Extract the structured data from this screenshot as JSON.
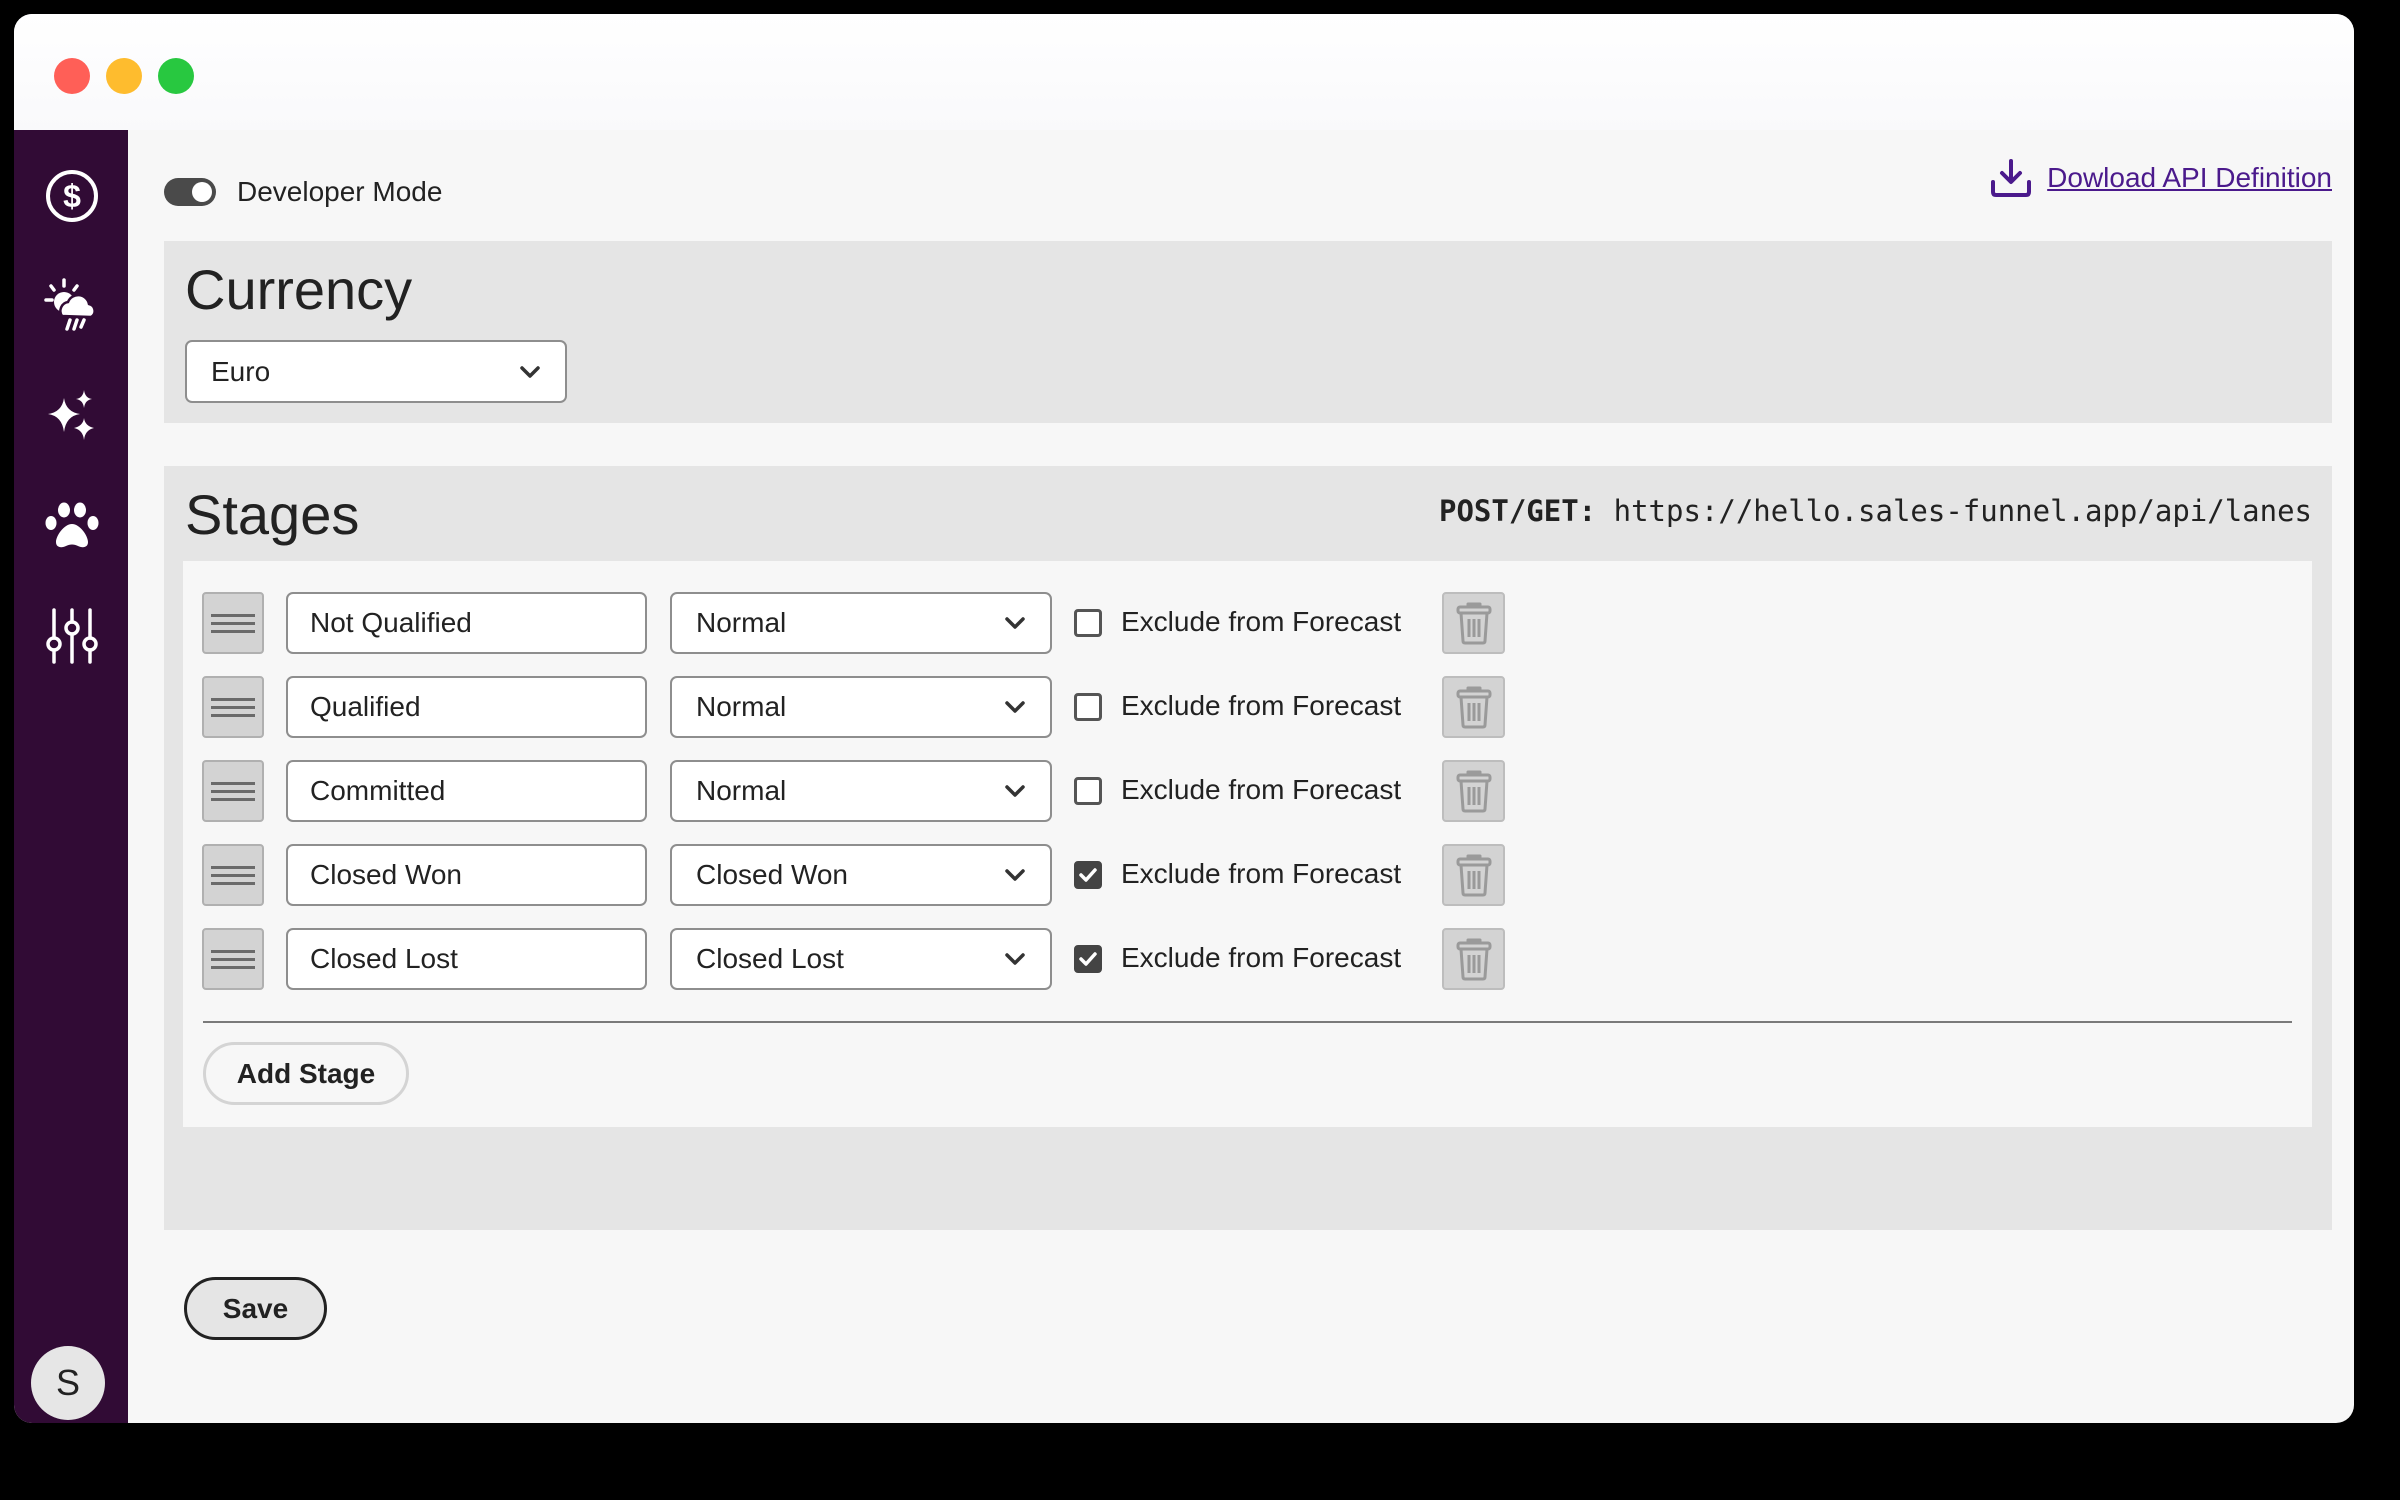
{
  "window": {
    "controls": [
      "close",
      "minimize",
      "maximize"
    ]
  },
  "sidebar": {
    "items": [
      {
        "icon": "dollar-circle-icon",
        "label": "Currency"
      },
      {
        "icon": "weather-sun-rain-icon",
        "label": "Forecast"
      },
      {
        "icon": "sparkles-icon",
        "label": "Magic"
      },
      {
        "icon": "paw-icon",
        "label": "Pets"
      },
      {
        "icon": "sliders-icon",
        "label": "Settings"
      }
    ],
    "avatar_initial": "S"
  },
  "header": {
    "developer_mode_label": "Developer Mode",
    "developer_mode_on": true,
    "download_label": "Dowload API Definition"
  },
  "currency": {
    "title": "Currency",
    "selected": "Euro"
  },
  "stages": {
    "title": "Stages",
    "endpoint_method": "POST/GET:",
    "endpoint_url": "https://hello.sales-funnel.app/api/lanes",
    "exclude_label": "Exclude from Forecast",
    "rows": [
      {
        "name": "Not Qualified",
        "type": "Normal",
        "exclude": false
      },
      {
        "name": "Qualified",
        "type": "Normal",
        "exclude": false
      },
      {
        "name": "Committed",
        "type": "Normal",
        "exclude": false
      },
      {
        "name": "Closed Won",
        "type": "Closed Won",
        "exclude": true
      },
      {
        "name": "Closed Lost",
        "type": "Closed Lost",
        "exclude": true
      }
    ],
    "add_label": "Add Stage",
    "save_label": "Save"
  },
  "colors": {
    "sidebar": "#310b35",
    "link": "#4b1a8c",
    "panel": "#e5e5e5",
    "background": "#f7f7f7"
  }
}
